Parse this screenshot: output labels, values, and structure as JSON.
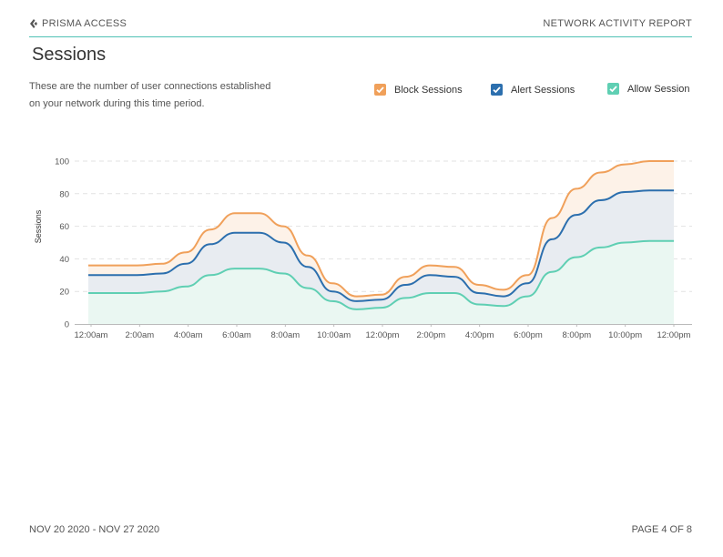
{
  "header": {
    "brand": "PRISMA ACCESS",
    "report_title": "NETWORK ACTIVITY REPORT"
  },
  "page": {
    "title": "Sessions",
    "description_line1": "These are the number of user connections established",
    "description_line2": "on your network during this time period."
  },
  "legend": {
    "items": [
      {
        "label": "Block Sessions",
        "color": "#f0a05a"
      },
      {
        "label": "Alert Sessions",
        "color": "#2c6fae"
      },
      {
        "label": "Allow Session",
        "color": "#5fcfb3"
      }
    ]
  },
  "chart_data": {
    "type": "area",
    "ylabel": "Sessions",
    "ylim": [
      0,
      100
    ],
    "yticks": [
      0,
      20,
      40,
      60,
      80,
      100
    ],
    "xtick_labels": [
      "12:00am",
      "2:00am",
      "4:00am",
      "6:00am",
      "8:00am",
      "10:00am",
      "12:00pm",
      "2:00pm",
      "4:00pm",
      "6:00pm",
      "8:00pm",
      "10:00pm",
      "12:00pm"
    ],
    "x_hours": [
      0,
      1,
      2,
      3,
      4,
      5,
      6,
      7,
      8,
      9,
      10,
      11,
      12,
      13,
      14,
      15,
      16,
      17,
      18,
      19,
      20,
      21,
      22,
      23,
      24
    ],
    "series": [
      {
        "name": "Block Sessions",
        "color": "#f0a05a",
        "values": [
          36,
          36,
          36,
          37,
          44,
          58,
          68,
          68,
          60,
          42,
          25,
          17,
          18,
          29,
          36,
          35,
          24,
          21,
          30,
          65,
          83,
          93,
          98,
          100,
          100
        ]
      },
      {
        "name": "Alert Sessions",
        "color": "#2c6fae",
        "values": [
          30,
          30,
          30,
          31,
          37,
          49,
          56,
          56,
          50,
          35,
          20,
          14,
          15,
          24,
          30,
          29,
          19,
          17,
          25,
          52,
          67,
          76,
          81,
          82,
          82
        ]
      },
      {
        "name": "Allow Session",
        "color": "#5fcfb3",
        "values": [
          19,
          19,
          19,
          20,
          23,
          30,
          34,
          34,
          31,
          22,
          14,
          9,
          10,
          16,
          19,
          19,
          12,
          11,
          17,
          32,
          41,
          47,
          50,
          51,
          51
        ]
      }
    ],
    "grid": true
  },
  "footer": {
    "date_range": "NOV 20 2020 - NOV 27 2020",
    "page": "PAGE 4 OF 8"
  }
}
